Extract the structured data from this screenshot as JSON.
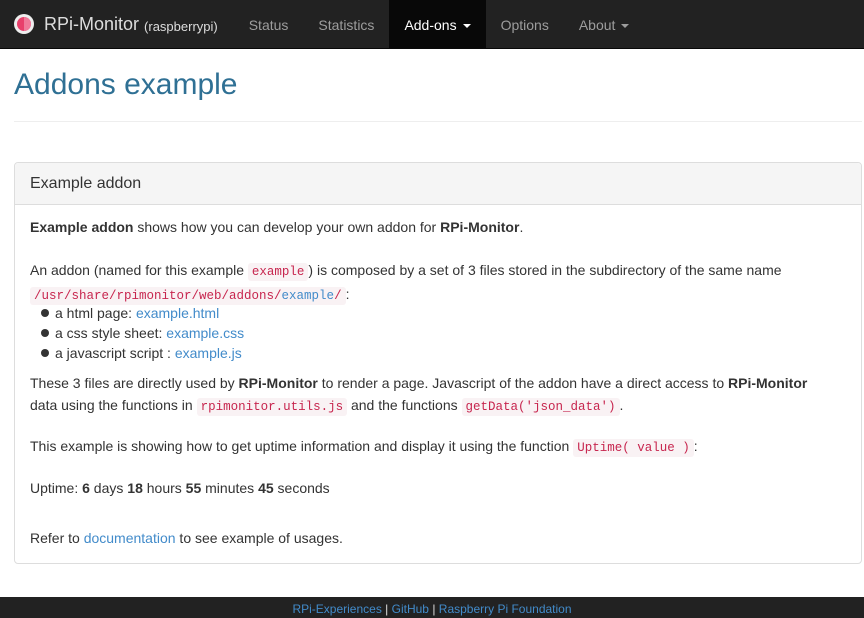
{
  "navbar": {
    "brand_title": "RPi-Monitor",
    "brand_host": "(raspberrypi)",
    "items": [
      {
        "label": "Status"
      },
      {
        "label": "Statistics"
      },
      {
        "label": "Add-ons"
      },
      {
        "label": "Options"
      },
      {
        "label": "About"
      }
    ]
  },
  "page": {
    "title": "Addons example"
  },
  "panel": {
    "heading": "Example addon",
    "intro": {
      "bold1": "Example addon",
      "text1": " shows how you can develop your own addon for ",
      "bold2": "RPi-Monitor",
      "text2": "."
    },
    "addon": {
      "text1": "An addon (named for this example ",
      "code1": "example",
      "text2": ") is composed by a set of 3 files stored in the subdirectory of the same name",
      "path_prefix": "/usr/share/rpimonitor/web/addons/",
      "path_link": "example",
      "path_suffix": "/",
      "text3": ":"
    },
    "files": [
      {
        "label": "a html page: ",
        "link": "example.html"
      },
      {
        "label": "a css style sheet: ",
        "link": "example.css"
      },
      {
        "label": "a javascript script : ",
        "link": "example.js"
      }
    ],
    "usage": {
      "text1": "These 3 files are directly used by ",
      "bold1": "RPi-Monitor",
      "text2": " to render a page. Javascript of the addon have a direct access to ",
      "bold2": "RPi-Monitor",
      "text3": "data using the functions in ",
      "code1": "rpimonitor.utils.js",
      "text4": " and the functions ",
      "code2": "getData('json_data')",
      "text5": "."
    },
    "uptime_intro": {
      "text1": "This example is showing how to get uptime information and display it using the function ",
      "code1": "Uptime( value )",
      "text2": ":"
    },
    "uptime": {
      "label": "Uptime: ",
      "days": "6",
      "days_unit": " days ",
      "hours": "18",
      "hours_unit": " hours ",
      "minutes": "55",
      "minutes_unit": " minutes ",
      "seconds": "45",
      "seconds_unit": " seconds"
    },
    "refer": {
      "text1": "Refer to ",
      "link": "documentation",
      "text2": " to see example of usages."
    }
  },
  "footer": {
    "link1": "RPi-Experiences",
    "sep1": " | ",
    "link2": "GitHub",
    "sep2": " | ",
    "link3": "Raspberry Pi Foundation"
  }
}
